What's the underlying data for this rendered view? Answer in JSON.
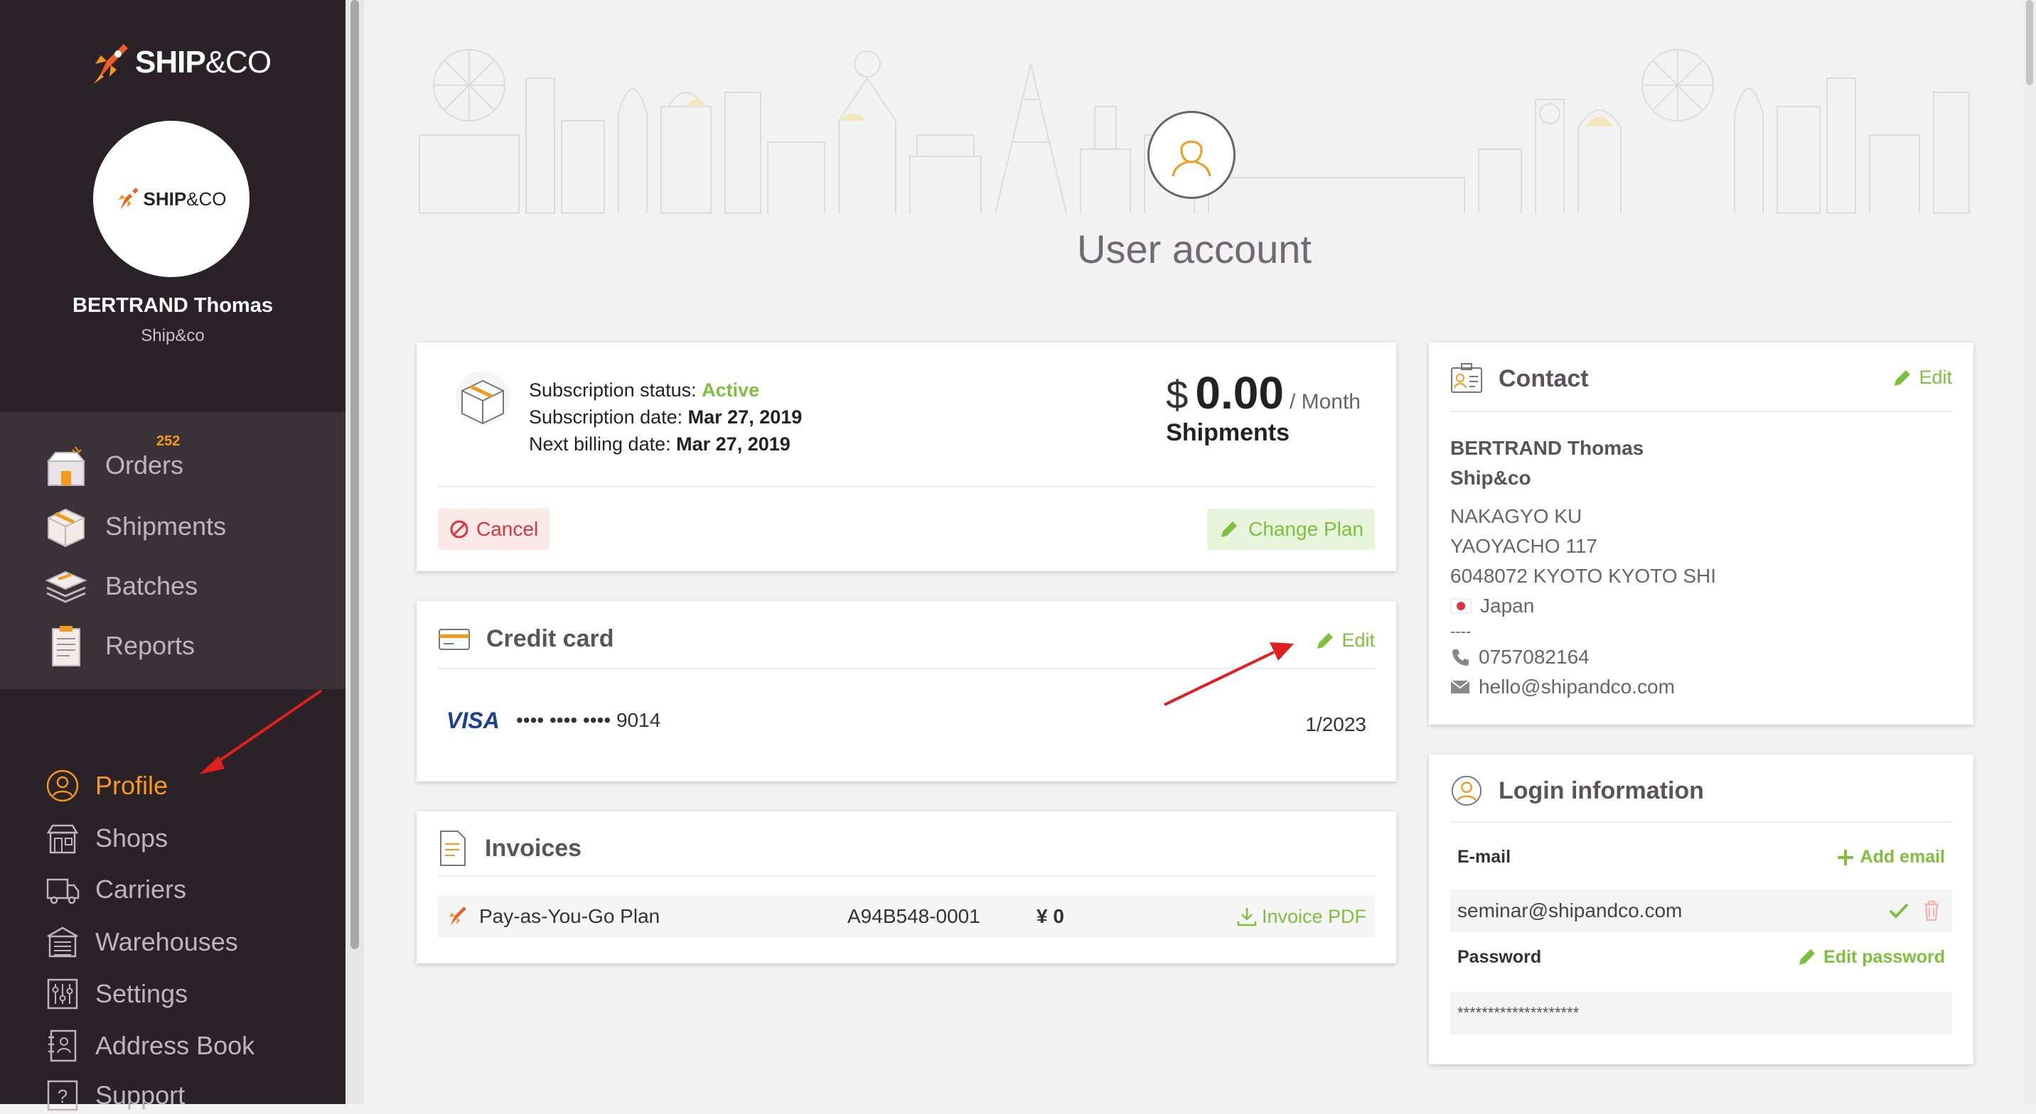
{
  "brand": {
    "name": "SHIP",
    "amp": "&CO"
  },
  "user": {
    "name": "BERTRAND Thomas",
    "company": "Ship&co"
  },
  "nav_main": [
    {
      "label": "Orders",
      "icon": "orders-icon",
      "badge": "252"
    },
    {
      "label": "Shipments",
      "icon": "shipments-icon"
    },
    {
      "label": "Batches",
      "icon": "batches-icon"
    },
    {
      "label": "Reports",
      "icon": "reports-icon"
    }
  ],
  "nav_secondary": [
    {
      "label": "Profile",
      "icon": "profile-icon",
      "active": true
    },
    {
      "label": "Shops",
      "icon": "shops-icon"
    },
    {
      "label": "Carriers",
      "icon": "carriers-icon"
    },
    {
      "label": "Warehouses",
      "icon": "warehouses-icon"
    },
    {
      "label": "Settings",
      "icon": "settings-icon"
    },
    {
      "label": "Address Book",
      "icon": "address-book-icon"
    },
    {
      "label": "Support",
      "icon": "support-icon"
    }
  ],
  "page": {
    "title": "User account"
  },
  "subscription": {
    "status_label": "Subscription status:",
    "status_value": "Active",
    "date_label": "Subscription date:",
    "date_value": "Mar 27, 2019",
    "billing_label": "Next billing date:",
    "billing_value": "Mar 27, 2019",
    "currency": "$",
    "amount": "0.00",
    "per": "Month",
    "unit": "Shipments",
    "cancel_label": "Cancel",
    "change_label": "Change Plan"
  },
  "credit_card": {
    "title": "Credit card",
    "edit_label": "Edit",
    "brand": "VISA",
    "masked": "•••• •••• •••• 9014",
    "expiry": "1/2023"
  },
  "invoices": {
    "title": "Invoices",
    "rows": [
      {
        "plan": "Pay-as-You-Go Plan",
        "number": "A94B548-0001",
        "amount": "¥ 0",
        "pdf_label": "Invoice PDF"
      }
    ]
  },
  "contact": {
    "title": "Contact",
    "edit_label": "Edit",
    "name": "BERTRAND Thomas",
    "company": "Ship&co",
    "address1": "NAKAGYO KU",
    "address2": "YAOYACHO 117",
    "address3": "6048072 KYOTO KYOTO SHI",
    "country": "Japan",
    "separator": "----",
    "phone": "0757082164",
    "email": "hello@shipandco.com"
  },
  "login": {
    "title": "Login information",
    "email_label": "E-mail",
    "add_email_label": "Add email",
    "email_value": "seminar@shipandco.com",
    "password_label": "Password",
    "edit_password_label": "Edit password",
    "password_value": "********************"
  },
  "colors": {
    "accent_orange": "#f39a1d",
    "accent_green": "#7ec03c",
    "danger": "#d9363e",
    "sidebar": "#2a2227",
    "annotation_arrow": "#e02020"
  }
}
